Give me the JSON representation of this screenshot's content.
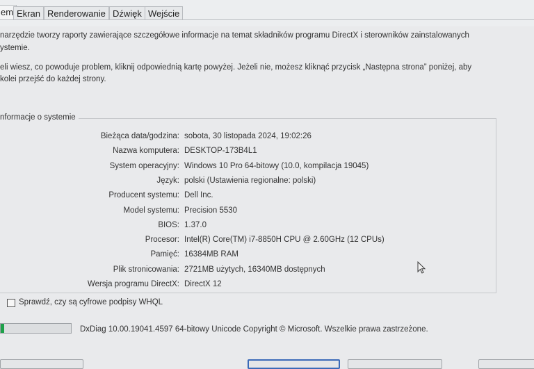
{
  "tabs": [
    {
      "label": "em",
      "active": true
    },
    {
      "label": "Ekran"
    },
    {
      "label": "Renderowanie"
    },
    {
      "label": "Dźwięk"
    },
    {
      "label": "Wejście"
    }
  ],
  "intro": {
    "line1": "narzędzie tworzy raporty zawierające szczegółowe informacje na temat składników programu DirectX i sterowników zainstalowanych",
    "line2": "ystemie.",
    "line3": "eli wiesz, co powoduje problem, kliknij odpowiednią kartę powyżej. Jeżeli nie, możesz kliknąć przycisk „Następna strona” poniżej, aby",
    "line4": "kolei przejść do każdej strony."
  },
  "system_info": {
    "title": "nformacje o systemie",
    "rows": [
      {
        "label": "Bieżąca data/godzina:",
        "value": "sobota, 30 listopada 2024, 19:02:26"
      },
      {
        "label": "Nazwa komputera:",
        "value": "DESKTOP-173B4L1"
      },
      {
        "label": "System operacyjny:",
        "value": "Windows 10 Pro 64-bitowy (10.0, kompilacja 19045)"
      },
      {
        "label": "Język:",
        "value": "polski (Ustawienia regionalne: polski)"
      },
      {
        "label": "Producent systemu:",
        "value": "Dell Inc."
      },
      {
        "label": "Model systemu:",
        "value": "Precision 5530"
      },
      {
        "label": "BIOS:",
        "value": "1.37.0"
      },
      {
        "label": "Procesor:",
        "value": "Intel(R) Core(TM) i7-8850H CPU @ 2.60GHz (12 CPUs)"
      },
      {
        "label": "Pamięć:",
        "value": "16384MB RAM"
      },
      {
        "label": "Plik stronicowania:",
        "value": "2721MB użytych, 16340MB dostępnych"
      },
      {
        "label": "Wersja programu DirectX:",
        "value": "DirectX 12"
      }
    ]
  },
  "whql_checkbox": {
    "label": "Sprawdź, czy są cyfrowe podpisy WHQL",
    "checked": false
  },
  "progress": {
    "fraction": 0.05,
    "color": "#1ea14a"
  },
  "footer": {
    "text": "DxDiag 10.00.19041.4597 64-bitowy Unicode  Copyright © Microsoft. Wszelkie prawa zastrzeżone."
  },
  "icons": {
    "cursor": "mouse-pointer-icon"
  }
}
